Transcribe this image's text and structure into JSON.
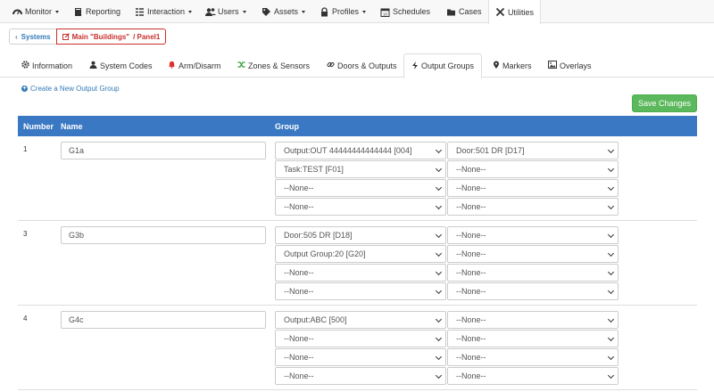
{
  "nav": {
    "items": [
      {
        "label": "Monitor",
        "icon": "dashboard-icon",
        "caret": true
      },
      {
        "label": "Reporting",
        "icon": "book-icon",
        "caret": false
      },
      {
        "label": "Interaction",
        "icon": "tasks-icon",
        "caret": true
      },
      {
        "label": "Users",
        "icon": "users-icon",
        "caret": true
      },
      {
        "label": "Assets",
        "icon": "tags-icon",
        "caret": true
      },
      {
        "label": "Profiles",
        "icon": "lock-icon",
        "caret": true
      },
      {
        "label": "Schedules",
        "icon": "calendar-icon",
        "caret": false
      },
      {
        "label": "Cases",
        "icon": "folder-icon",
        "caret": false
      },
      {
        "label": "Utilities",
        "icon": "wrench-icon",
        "caret": false,
        "active": true
      }
    ]
  },
  "breadcrumb": {
    "systems": "Systems",
    "building": "Main \"Buildings\"",
    "panel": "/ Panel1"
  },
  "tabs": [
    {
      "label": "Information",
      "icon": "gear-icon"
    },
    {
      "label": "System Codes",
      "icon": "user-icon"
    },
    {
      "label": "Arm/Disarm",
      "icon": "bell-icon"
    },
    {
      "label": "Zones & Sensors",
      "icon": "shuffle-icon"
    },
    {
      "label": "Doors & Outputs",
      "icon": "link-icon"
    },
    {
      "label": "Output Groups",
      "icon": "bolt-icon",
      "active": true
    },
    {
      "label": "Markers",
      "icon": "map-marker-icon"
    },
    {
      "label": "Overlays",
      "icon": "image-icon"
    }
  ],
  "actions": {
    "create_label": "Create a New Output Group",
    "save_label": "Save Changes"
  },
  "table": {
    "headers": {
      "number": "Number",
      "name": "Name",
      "group": "Group"
    },
    "rows": [
      {
        "number": "1",
        "name": "G1a",
        "selects": [
          [
            "Output:OUT 44444444444444 [004]",
            "Door:501 DR [D17]"
          ],
          [
            "Task:TEST [F01]",
            "--None--"
          ],
          [
            "--None--",
            "--None--"
          ],
          [
            "--None--",
            "--None--"
          ]
        ]
      },
      {
        "number": "3",
        "name": "G3b",
        "selects": [
          [
            "Door:505 DR [D18]",
            "--None--"
          ],
          [
            "Output Group:20 [G20]",
            "--None--"
          ],
          [
            "--None--",
            "--None--"
          ],
          [
            "--None--",
            "--None--"
          ]
        ]
      },
      {
        "number": "4",
        "name": "G4c",
        "selects": [
          [
            "Output:ABC [500]",
            "--None--"
          ],
          [
            "--None--",
            "--None--"
          ],
          [
            "--None--",
            "--None--"
          ],
          [
            "--None--",
            "--None--"
          ]
        ]
      }
    ]
  },
  "colors": {
    "header_blue": "#3a78c3",
    "save_green": "#5cb85c",
    "link_blue": "#337ab7",
    "alert_red": "#c9302c"
  }
}
